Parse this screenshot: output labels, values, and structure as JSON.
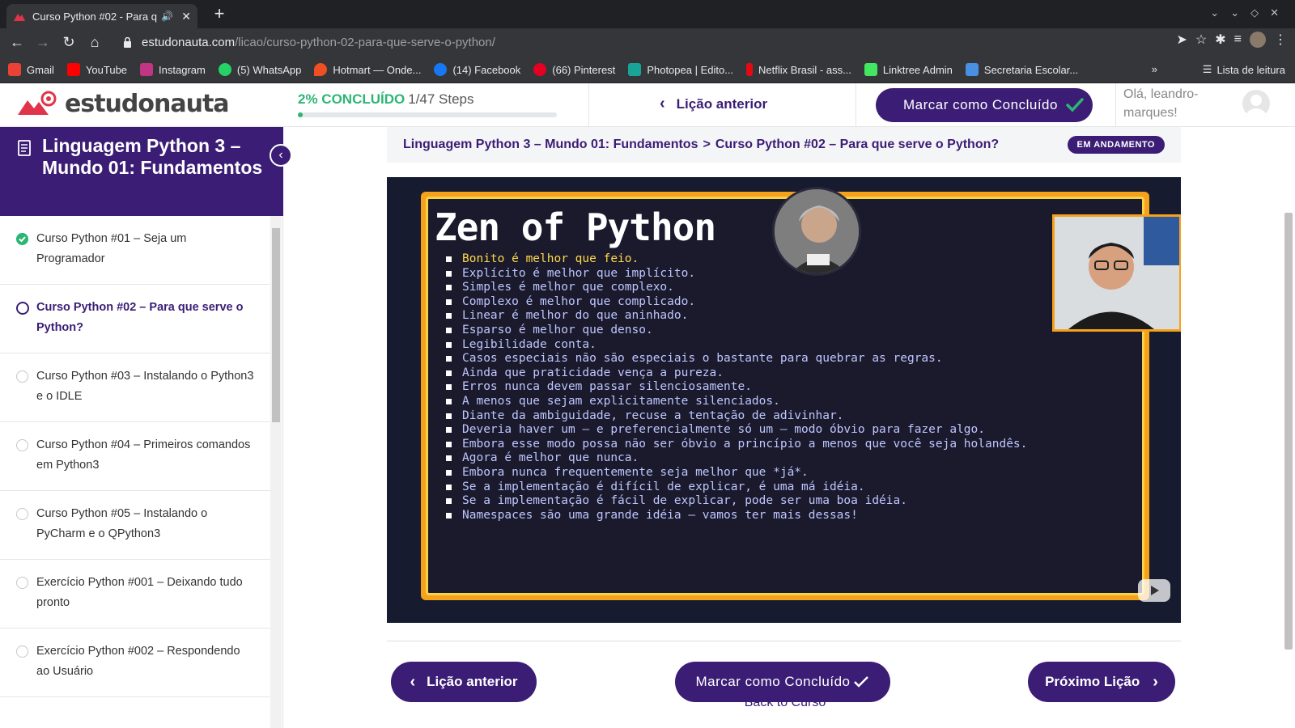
{
  "browser": {
    "tab_title": "Curso Python #02 - Para q",
    "url_host": "estudonauta.com",
    "url_path": "/licao/curso-python-02-para-que-serve-o-python/",
    "bookmarks": [
      {
        "label": "Gmail",
        "color": "#ea4335"
      },
      {
        "label": "YouTube",
        "color": "#ff0000"
      },
      {
        "label": "Instagram",
        "color": "#c13584"
      },
      {
        "label": "(5) WhatsApp",
        "color": "#25d366"
      },
      {
        "label": "Hotmart — Onde...",
        "color": "#f04e23"
      },
      {
        "label": "(14) Facebook",
        "color": "#1877f2"
      },
      {
        "label": "(66) Pinterest",
        "color": "#e60023"
      },
      {
        "label": "Photopea | Edito...",
        "color": "#18a497"
      },
      {
        "label": "Netflix Brasil - ass...",
        "color": "#e50914"
      },
      {
        "label": "Linktree Admin",
        "color": "#43e660"
      },
      {
        "label": "Secretaria Escolar...",
        "color": "#4a90e2"
      }
    ],
    "bookmarks_more": "»",
    "reading_list": "Lista de leitura"
  },
  "header": {
    "logo_text": "estudonauta",
    "progress_pct_label": "2% CONCLUÍDO",
    "progress_steps": "1/47 Steps",
    "progress_value": 0.02,
    "prev_lesson": "Lição anterior",
    "mark_complete": "Marcar como Concluído",
    "greeting": "Olá, leandro-marques!"
  },
  "sidebar": {
    "course_title": "Linguagem Python 3 – Mundo 01: Fundamentos",
    "lessons": [
      {
        "title": "Curso Python #01 – Seja um Programador",
        "status": "done"
      },
      {
        "title": "Curso Python #02 – Para que serve o Python?",
        "status": "current"
      },
      {
        "title": "Curso Python #03 – Instalando o Python3 e o IDLE",
        "status": "todo"
      },
      {
        "title": "Curso Python #04 – Primeiros comandos em Python3",
        "status": "todo"
      },
      {
        "title": "Curso Python #05 – Instalando o PyCharm e o QPython3",
        "status": "todo"
      },
      {
        "title": "Exercício Python #001 – Deixando tudo pronto",
        "status": "todo"
      },
      {
        "title": "Exercício Python #002 – Respondendo ao Usuário",
        "status": "todo"
      }
    ]
  },
  "main": {
    "breadcrumb_course": "Linguagem Python 3 – Mundo 01: Fundamentos",
    "breadcrumb_sep": ">",
    "breadcrumb_lesson": "Curso Python #02 – Para que serve o Python?",
    "status_badge": "EM ANDAMENTO",
    "video": {
      "title": "Zen of Python",
      "lines": [
        "Bonito é melhor que feio.",
        "Explícito é melhor que implícito.",
        "Simples é melhor que complexo.",
        "Complexo é melhor que complicado.",
        "Linear é melhor do que aninhado.",
        "Esparso é melhor que denso.",
        "Legibilidade conta.",
        "Casos especiais não são especiais o bastante para quebrar as regras.",
        "Ainda que praticidade vença a pureza.",
        "Erros nunca devem passar silenciosamente.",
        "A menos que sejam explicitamente silenciados.",
        "Diante da ambiguidade, recuse a tentação de adivinhar.",
        "Deveria haver um — e preferencialmente só um — modo óbvio para fazer algo.",
        "Embora esse modo possa não ser óbvio a princípio a menos que você seja holandês.",
        "Agora é melhor que nunca.",
        "Embora nunca frequentemente seja melhor que *já*.",
        "Se a implementação é difícil de explicar, é uma má idéia.",
        "Se a implementação é fácil de explicar, pode ser uma boa idéia.",
        "Namespaces são uma grande idéia — vamos ter mais dessas!"
      ]
    },
    "prev_button": "Lição anterior",
    "complete_button": "Marcar como Concluído",
    "next_button": "Próximo Lição",
    "back_to_course": "Back to Curso"
  },
  "colors": {
    "brand": "#3b1d75",
    "success": "#2cb673",
    "accent": "#f6a11b"
  }
}
